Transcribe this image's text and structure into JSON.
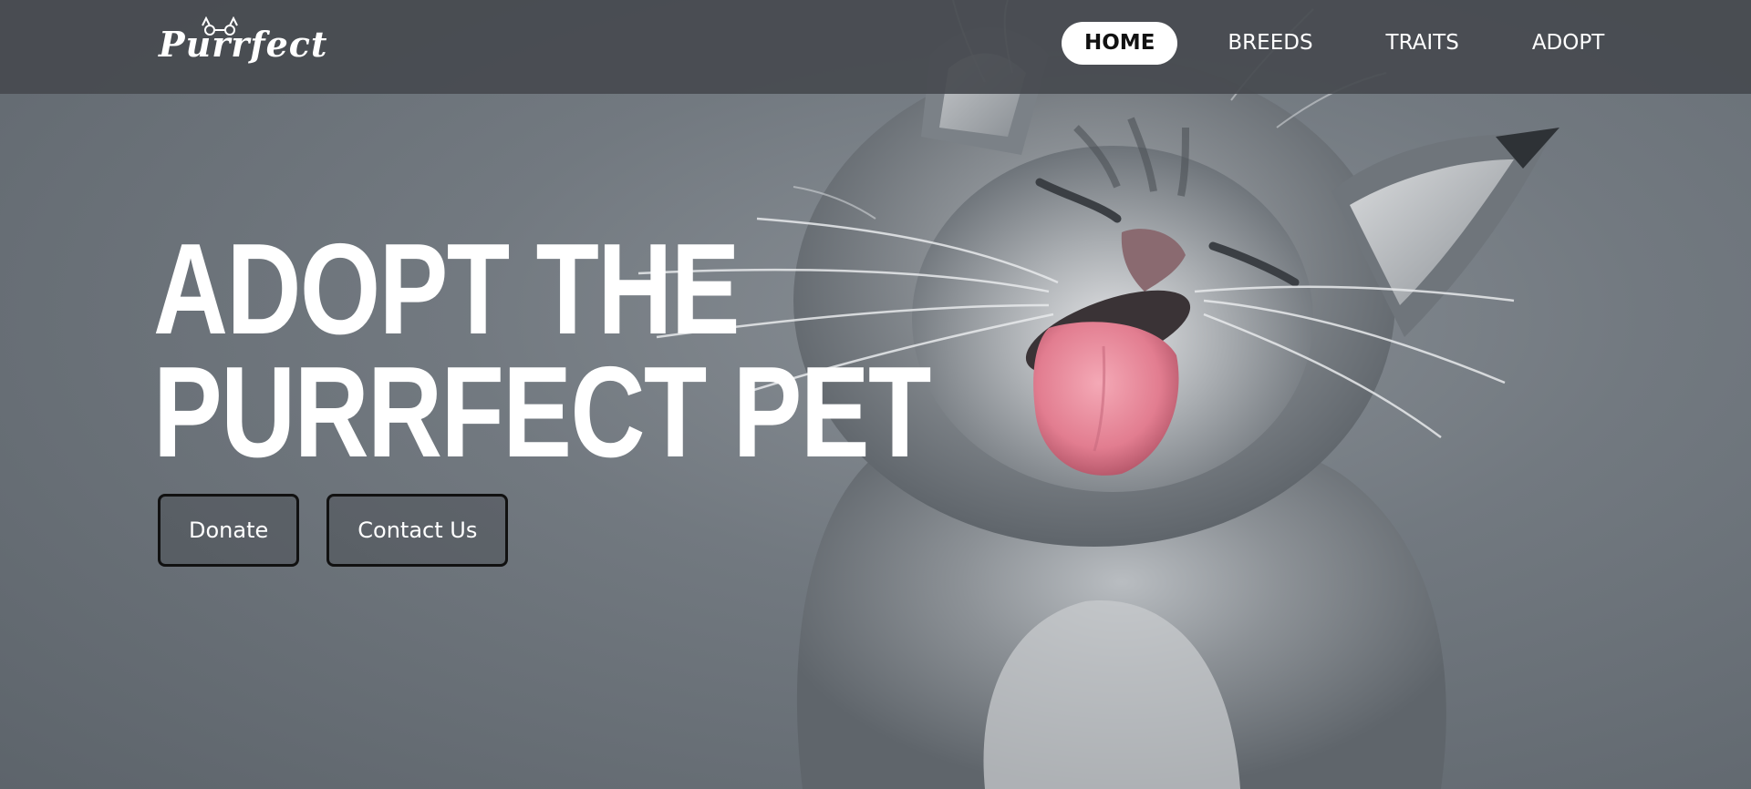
{
  "brand": {
    "logo_text": "Purrfect"
  },
  "nav": {
    "items": [
      {
        "label": "HOME",
        "active": true
      },
      {
        "label": "BREEDS",
        "active": false
      },
      {
        "label": "TRAITS",
        "active": false
      },
      {
        "label": "ADOPT",
        "active": false
      }
    ]
  },
  "hero": {
    "headline_line1": "ADOPT THE",
    "headline_line2": "PURRFECT PET",
    "buttons": {
      "donate": "Donate",
      "contact": "Contact Us"
    },
    "image_subject": "grey fluffy kitten sticking out its pink tongue"
  },
  "colors": {
    "header_bg": "#464a4f",
    "background": "#727980",
    "active_nav_bg": "#ffffff",
    "tongue": "#e88a9a"
  }
}
